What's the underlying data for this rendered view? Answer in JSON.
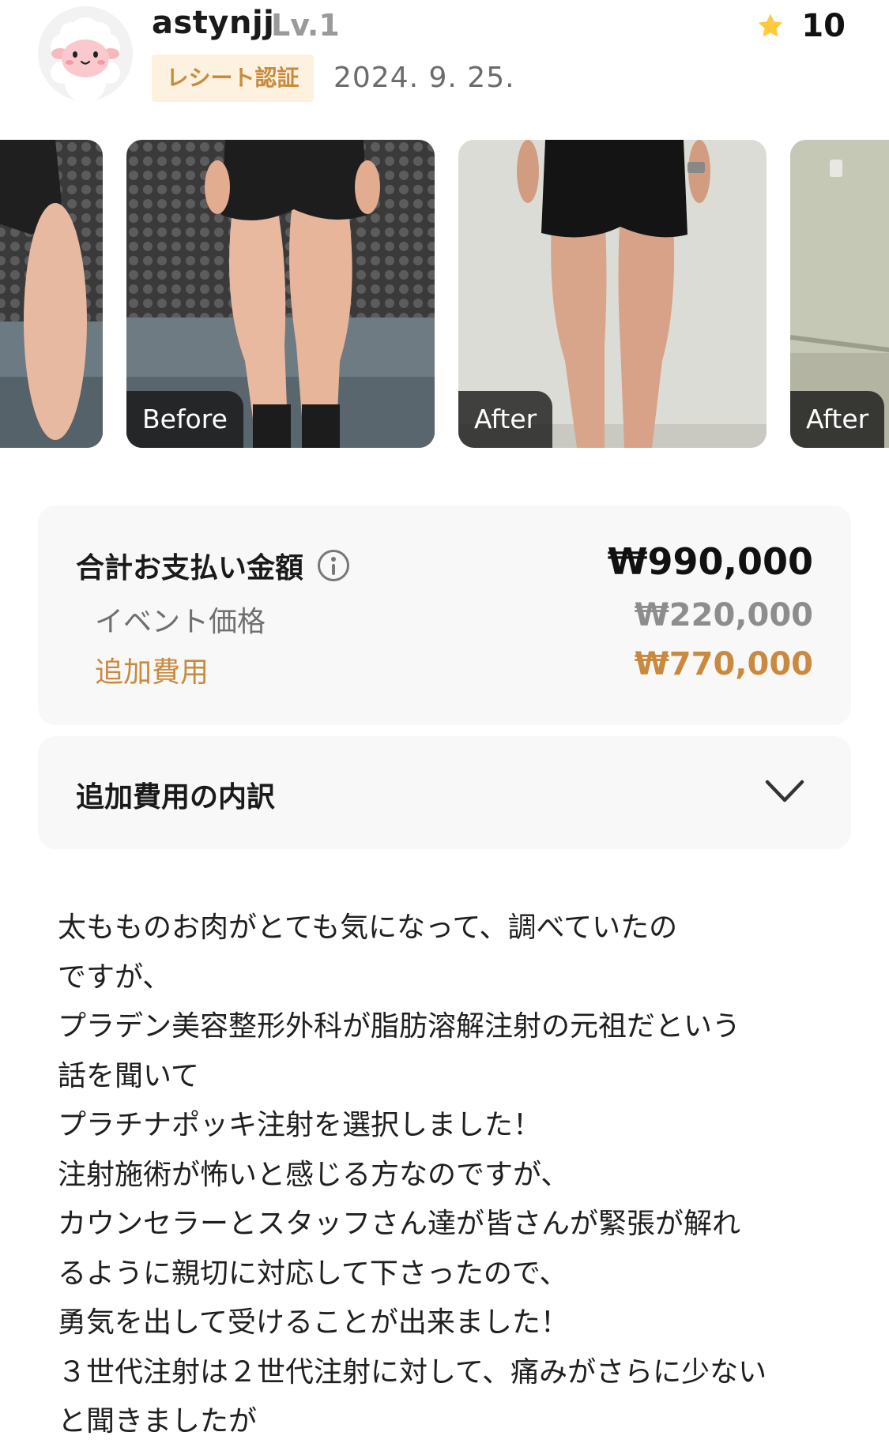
{
  "header": {
    "username": "astynjj",
    "level": "Lv.1",
    "badge": "レシート認証",
    "date": "2024. 9. 25.",
    "rating": "10",
    "icons": {
      "avatar": "sheep-avatar-icon",
      "rating": "star-icon"
    },
    "colors": {
      "badge_bg": "#fdf1df",
      "badge_text": "#c98a3f",
      "star": "#ffc93c"
    }
  },
  "photos": [
    {
      "label": ""
    },
    {
      "label": "Before"
    },
    {
      "label": "After"
    },
    {
      "label": "After"
    }
  ],
  "price": {
    "total_label": "合計お支払い金額",
    "total_amount": "₩990,000",
    "event_label": "イベント価格",
    "event_amount": "₩220,000",
    "extra_label": "追加費用",
    "extra_amount": "₩770,000",
    "icons": {
      "info": "info-icon"
    },
    "colors": {
      "accent": "#c98a3f"
    }
  },
  "breakdown": {
    "label": "追加費用の内訳",
    "icon": "chevron-down-icon"
  },
  "review": {
    "lines": [
      "太もものお肉がとても気になって、調べていたの",
      "ですが、",
      "プラデン美容整形外科が脂肪溶解注射の元祖だという",
      "話を聞いて",
      "プラチナポッキ注射を選択しました！",
      "注射施術が怖いと感じる方なのですが、",
      "カウンセラーとスタッフさん達が皆さんが緊張が解れ",
      "るように親切に対応して下さったので、",
      "勇気を出して受けることが出来ました！",
      "３世代注射は２世代注射に対して、痛みがさらに少ない",
      "と聞きましたが"
    ]
  }
}
